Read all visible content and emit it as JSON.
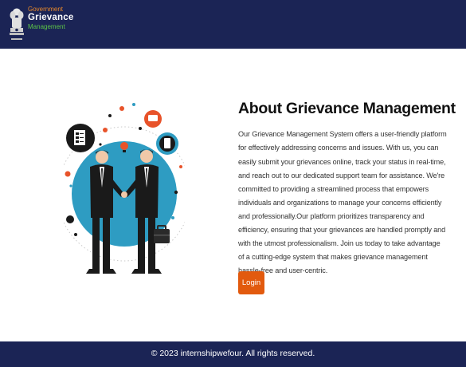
{
  "header": {
    "logo": {
      "line1": "Government",
      "line2": "Grievance",
      "line3": "Management"
    }
  },
  "about": {
    "title": "About Grievance Management",
    "description": "Our Grievance Management System offers a user-friendly platform for effectively addressing concerns and issues. With us, you can easily submit your grievances online, track your status in real-time, and reach out to our dedicated support team for assistance. We're committed to providing a streamlined process that empowers individuals and organizations to manage your concerns efficiently and professionally.Our platform prioritizes transparency and efficiency, ensuring that your grievances are handled promptly and with the utmost professionalism. Join us today to take advantage of a cutting-edge system that makes grievance management hassle-free and user-centric.",
    "login_label": "Login"
  },
  "illustration": {
    "icon": "business-handshake-illustration"
  },
  "footer": {
    "copyright": "© 2023 internshipwefour. All rights reserved."
  },
  "colors": {
    "navy": "#1b2455",
    "accent_orange": "#e25a0e",
    "logo_orange": "#e8882a",
    "logo_green": "#5cc548",
    "teal": "#2e9cc2"
  }
}
